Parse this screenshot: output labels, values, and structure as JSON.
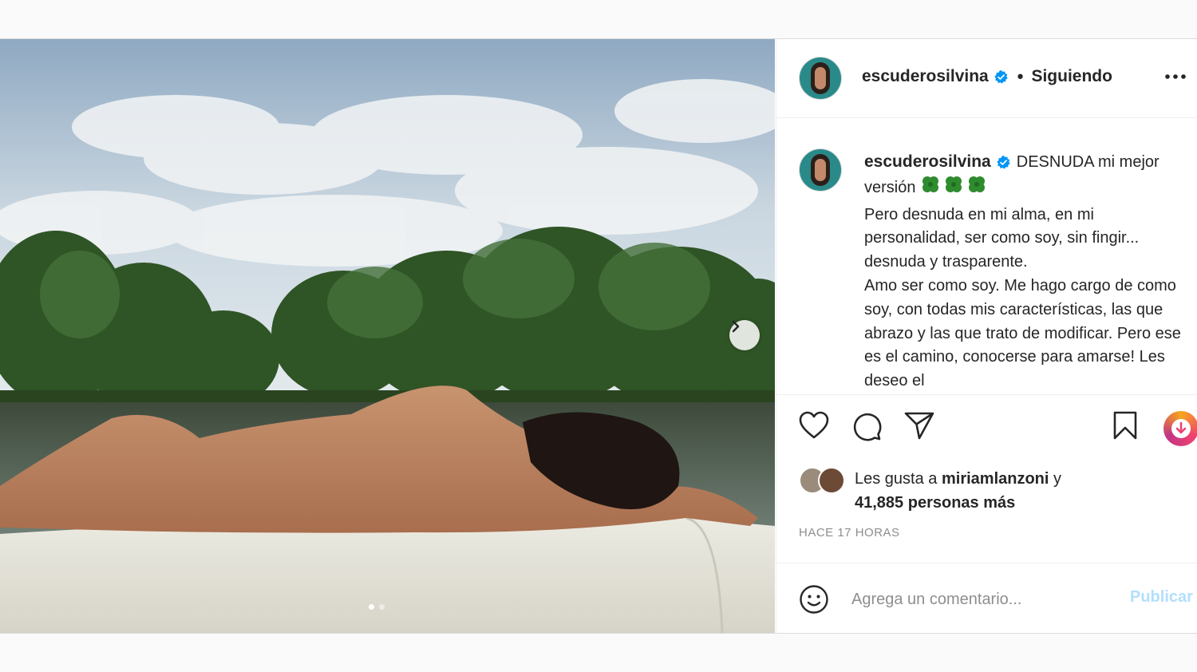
{
  "post": {
    "username": "escuderosilvina",
    "verified_icon": "verified-badge-icon",
    "separator": "•",
    "follow_status": "Siguiendo",
    "more_icon": "more-options-icon",
    "carousel": {
      "current_slide": 1,
      "total_slides": 2
    }
  },
  "caption": {
    "username": "escuderosilvina",
    "title_text": "DESNUDA mi mejor versión",
    "emoji": [
      "🍀",
      "🍀",
      "🍀"
    ],
    "lines": [
      "Pero desnuda en mi alma, en mi personalidad, ser como soy, sin fingir... desnuda y trasparente.",
      "Amo ser como soy. Me hago cargo de como soy, con todas mis características, las que abrazo y las que trato de modificar. Pero ese es el camino, conocerse para amarse! Les deseo el"
    ]
  },
  "actions": {
    "like_icon": "heart-icon",
    "comment_icon": "comment-bubble-icon",
    "share_icon": "paper-plane-icon",
    "save_icon": "bookmark-icon"
  },
  "likes": {
    "prefix": "Les gusta a",
    "liker": "miriamlanzoni",
    "conjunction": "y",
    "others": "41,885 personas más"
  },
  "timestamp": "HACE 17 HORAS",
  "comment": {
    "placeholder": "Agrega un comentario...",
    "publish_label": "Publicar"
  },
  "colors": {
    "accent_blue": "#0095f6",
    "publish_disabled": "#b2dffc",
    "muted_text": "#8e8e8e",
    "text": "#262626"
  }
}
